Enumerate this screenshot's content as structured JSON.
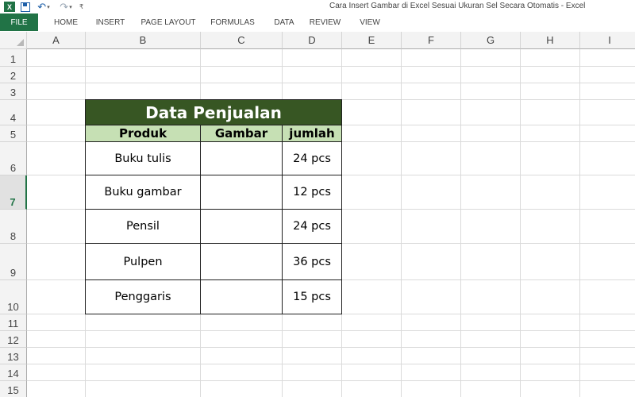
{
  "window": {
    "app_icon_letter": "X",
    "title": "Cara Insert Gambar di Excel Sesuai Ukuran Sel Secara Otomatis - Excel"
  },
  "quick_access": {
    "icons": [
      "excel-logo-icon",
      "save-icon",
      "undo-icon",
      "redo-icon",
      "customize-icon"
    ],
    "undo_glyph": "↶",
    "redo_glyph": "↷",
    "caret_glyph": "▾",
    "more_glyph": "₹"
  },
  "ribbon": {
    "tabs": [
      {
        "label": "FILE"
      },
      {
        "label": "HOME"
      },
      {
        "label": "INSERT"
      },
      {
        "label": "PAGE LAYOUT"
      },
      {
        "label": "FORMULAS"
      },
      {
        "label": "DATA"
      },
      {
        "label": "REVIEW"
      },
      {
        "label": "VIEW"
      }
    ]
  },
  "sheet": {
    "columns": [
      "A",
      "B",
      "C",
      "D",
      "E",
      "F",
      "G",
      "H",
      "I"
    ],
    "rows": [
      "1",
      "2",
      "3",
      "4",
      "5",
      "6",
      "7",
      "8",
      "9",
      "10",
      "11",
      "12",
      "13",
      "14",
      "15"
    ],
    "active_row": "7"
  },
  "table": {
    "title": "Data Penjualan",
    "headers": [
      "Produk",
      "Gambar",
      "jumlah"
    ],
    "rows": [
      {
        "produk": "Buku tulis",
        "gambar": "",
        "jumlah": "24 pcs"
      },
      {
        "produk": "Buku gambar",
        "gambar": "",
        "jumlah": "12 pcs"
      },
      {
        "produk": "Pensil",
        "gambar": "",
        "jumlah": "24 pcs"
      },
      {
        "produk": "Pulpen",
        "gambar": "",
        "jumlah": "36 pcs"
      },
      {
        "produk": "Penggaris",
        "gambar": "",
        "jumlah": "15 pcs"
      }
    ]
  },
  "colors": {
    "file_tab": "#217346",
    "title_fill": "#375623",
    "header_fill": "#c6e0b4",
    "active_accent": "#217346"
  }
}
